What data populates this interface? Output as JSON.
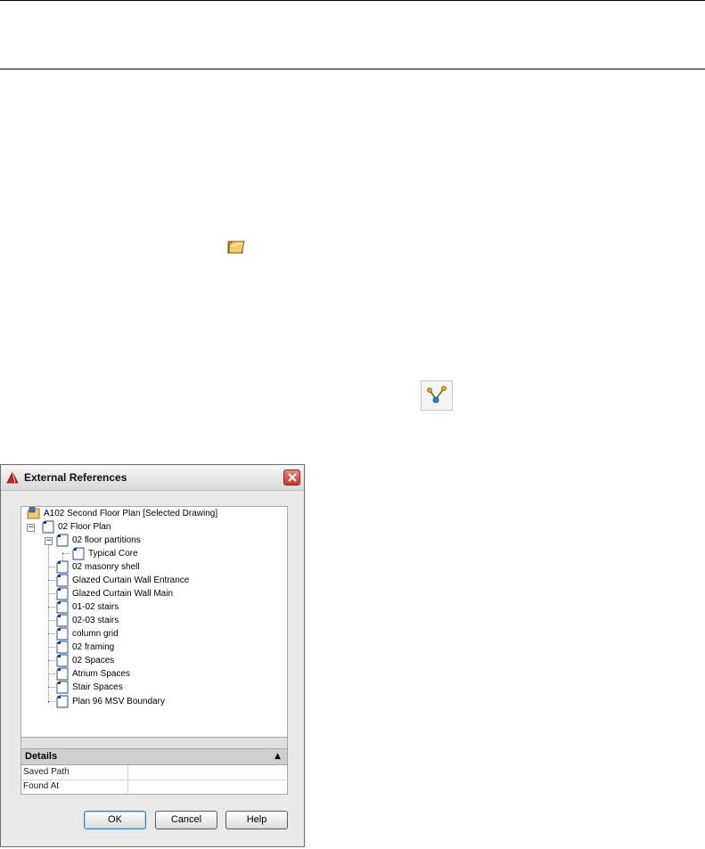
{
  "dialog": {
    "title": "External References",
    "tree": {
      "root": "A102 Second Floor Plan [Selected Drawing]",
      "items": [
        "02 Floor Plan",
        "02 floor partitions",
        "Typical Core",
        "02 masonry shell",
        "Glazed Curtain Wall Entrance",
        "Glazed Curtain Wall Main",
        "01-02 stairs",
        "02-03 stairs",
        "column grid",
        "02 framing",
        "02 Spaces",
        "Atrium Spaces",
        "Stair Spaces",
        "Plan 96 MSV Boundary"
      ]
    },
    "details": {
      "header": "Details",
      "rows": [
        {
          "key": "Saved Path",
          "value": ""
        },
        {
          "key": "Found At",
          "value": ""
        }
      ]
    },
    "buttons": {
      "ok": "OK",
      "cancel": "Cancel",
      "help": "Help"
    }
  },
  "icons": {
    "folder_button": "open-folder-icon",
    "path_button": "path-nodes-icon",
    "title": "autocad-logo-icon",
    "close": "close-icon"
  },
  "colors": {
    "close_button": "#c0392b",
    "folder": "#e3b64a",
    "accent": "#3c7fb1"
  }
}
